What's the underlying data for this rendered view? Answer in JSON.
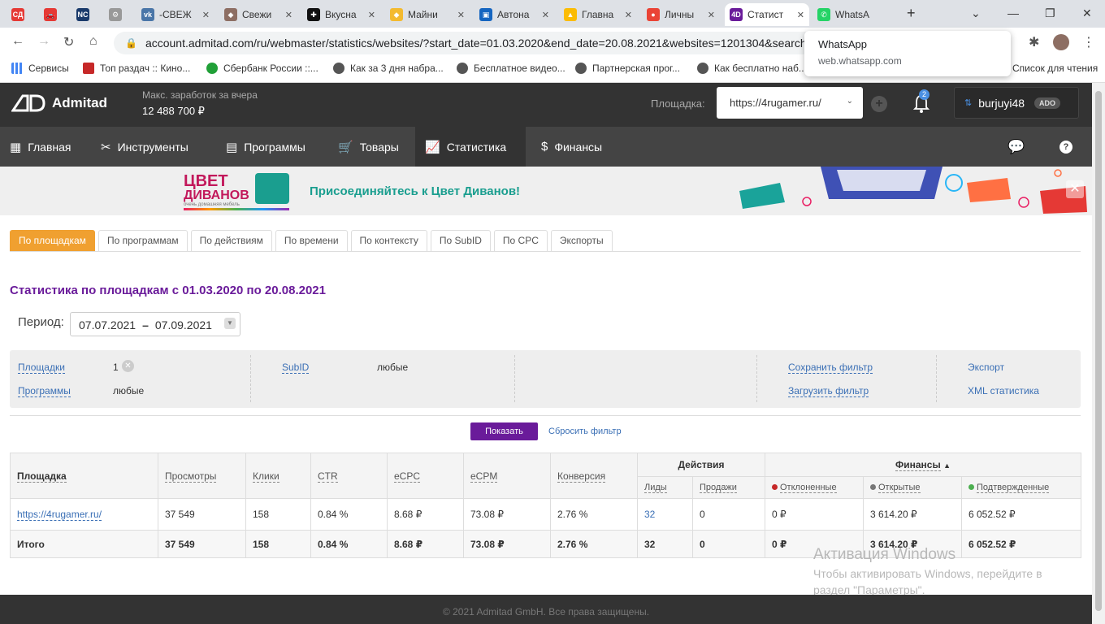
{
  "browser": {
    "tabs": [
      {
        "label": "",
        "color": "#e53935",
        "icon": "СД"
      },
      {
        "label": "",
        "color": "#e53935",
        "icon": "🚗"
      },
      {
        "label": "",
        "color": "#1a3a6b",
        "icon": "NC"
      },
      {
        "label": "",
        "color": "#999999",
        "icon": "⚙"
      },
      {
        "label": "-СВЕЖ",
        "color": "#4a76a8",
        "icon": "vk"
      },
      {
        "label": "Свежи",
        "color": "#8d6e63",
        "icon": "◆"
      },
      {
        "label": "Вкусна",
        "color": "#111111",
        "icon": "✚"
      },
      {
        "label": "Майни",
        "color": "#f3ba2f",
        "icon": "◆"
      },
      {
        "label": "Автона",
        "color": "#1565c0",
        "icon": "▣"
      },
      {
        "label": "Главна",
        "color": "#fbbc04",
        "icon": "▲"
      },
      {
        "label": "Личны",
        "color": "#ea4335",
        "icon": "●"
      },
      {
        "label": "Статист",
        "color": "#6a1b9a",
        "icon": "4D"
      },
      {
        "label": "WhatsA",
        "color": "#25d366",
        "icon": "✆"
      }
    ],
    "url": "account.admitad.com/ru/webmaster/statistics/websites/?start_date=01.03.2020&end_date=20.08.2021&websites=1201304&search=",
    "bookmarks": [
      "Сервисы",
      "Топ раздач :: Кино...",
      "Сбербанк России ::...",
      "Как за 3 дня набра...",
      "Бесплатное видео...",
      "Партнерская прог...",
      "Как бесплатно наб...",
      "Список для чтения"
    ],
    "popup": {
      "title": "WhatsApp",
      "url": "web.whatsapp.com"
    }
  },
  "header": {
    "brand": "Admitad",
    "earn_label": "Макс. заработок за вчера",
    "earn_value": "12 488 700 ₽",
    "platform_label": "Площадка:",
    "platform_value": "https://4rugamer.ru/",
    "notif_count": "2",
    "user": "burjuyi48",
    "user_badge": "ADO"
  },
  "nav": [
    "Главная",
    "Инструменты",
    "Программы",
    "Товары",
    "Статистика",
    "Финансы"
  ],
  "banner": {
    "logo_top": "ЦВЕТ",
    "logo_bottom": "ДИВАНОВ",
    "logo_tag": "очень домашняя мебель",
    "text": "Присоединяйтесь к Цвет Диванов!"
  },
  "subtabs": [
    "По площадкам",
    "По программам",
    "По действиям",
    "По времени",
    "По контексту",
    "По SubID",
    "По CPC",
    "Экспорты"
  ],
  "title": "Статистика по площадкам с 01.03.2020 по 20.08.2021",
  "period": {
    "label": "Период:",
    "from": "07.07.2021",
    "dash": "–",
    "to": "07.09.2021"
  },
  "filter": {
    "sites_label": "Площадки",
    "sites_value": "1",
    "programs_label": "Программы",
    "programs_value": "любые",
    "subid_label": "SubID",
    "subid_value": "любые",
    "save": "Сохранить фильтр",
    "load": "Загрузить фильтр",
    "export": "Экспорт",
    "xml": "XML статистика"
  },
  "buttons": {
    "show": "Показать",
    "reset": "Сбросить фильтр"
  },
  "table": {
    "headers": {
      "site": "Площадка",
      "views": "Просмотры",
      "clicks": "Клики",
      "ctr": "CTR",
      "ecpc": "eCPC",
      "ecpm": "eCPM",
      "conv": "Конверсия",
      "actions": "Действия",
      "leads": "Лиды",
      "sales": "Продажи",
      "finance": "Финансы",
      "rejected": "Отклоненные",
      "open": "Открытые",
      "confirmed": "Подтвержденные"
    },
    "row": {
      "site": "https://4rugamer.ru/",
      "views": "37 549",
      "clicks": "158",
      "ctr": "0.84 %",
      "ecpc": "8.68 ₽",
      "ecpm": "73.08 ₽",
      "conv": "2.76 %",
      "leads": "32",
      "sales": "0",
      "rejected": "0 ₽",
      "open": "3 614.20 ₽",
      "confirmed": "6 052.52 ₽"
    },
    "total": {
      "site": "Итого",
      "views": "37 549",
      "clicks": "158",
      "ctr": "0.84 %",
      "ecpc": "8.68 ₽",
      "ecpm": "73.08 ₽",
      "conv": "2.76 %",
      "leads": "32",
      "sales": "0",
      "rejected": "0 ₽",
      "open": "3 614.20 ₽",
      "confirmed": "6 052.52 ₽"
    }
  },
  "footer": "© 2021 Admitad GmbH. Все права защищены.",
  "watermark": {
    "title": "Активация Windows",
    "text": "Чтобы активировать Windows, перейдите в раздел \"Параметры\"."
  }
}
